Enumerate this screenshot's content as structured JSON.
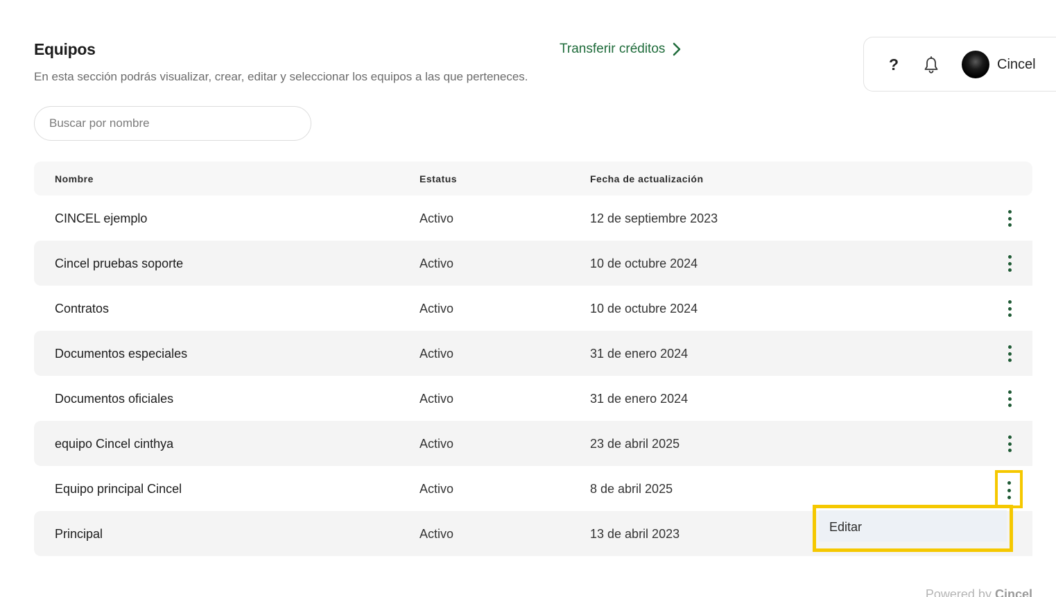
{
  "header": {
    "title": "Equipos",
    "subtitle": "En esta sección podrás visualizar, crear, editar y seleccionar los equipos a las que perteneces.",
    "transfer_label": "Transferir créditos"
  },
  "user_bar": {
    "help_label": "?",
    "user_name": "Cincel"
  },
  "search": {
    "placeholder": "Buscar por nombre"
  },
  "table": {
    "columns": [
      "Nombre",
      "Estatus",
      "Fecha de actualización"
    ],
    "rows": [
      {
        "name": "CINCEL ejemplo",
        "status": "Activo",
        "date": "12 de septiembre 2023"
      },
      {
        "name": "Cincel pruebas soporte",
        "status": "Activo",
        "date": "10 de octubre 2024"
      },
      {
        "name": "Contratos",
        "status": "Activo",
        "date": "10 de octubre 2024"
      },
      {
        "name": "Documentos especiales",
        "status": "Activo",
        "date": "31 de enero 2024"
      },
      {
        "name": "Documentos oficiales",
        "status": "Activo",
        "date": "31 de enero 2024"
      },
      {
        "name": "equipo Cincel cinthya",
        "status": "Activo",
        "date": "23 de abril 2025"
      },
      {
        "name": "Equipo principal Cincel",
        "status": "Activo",
        "date": "8 de abril 2025"
      },
      {
        "name": "Principal",
        "status": "Activo",
        "date": "13 de abril 2023"
      }
    ]
  },
  "context_menu": {
    "edit_label": "Editar"
  },
  "footer": {
    "powered_prefix": "Powered by",
    "powered_brand": "Cincel"
  },
  "colors": {
    "accent": "#1e6b3a",
    "highlight": "#f5c800"
  }
}
